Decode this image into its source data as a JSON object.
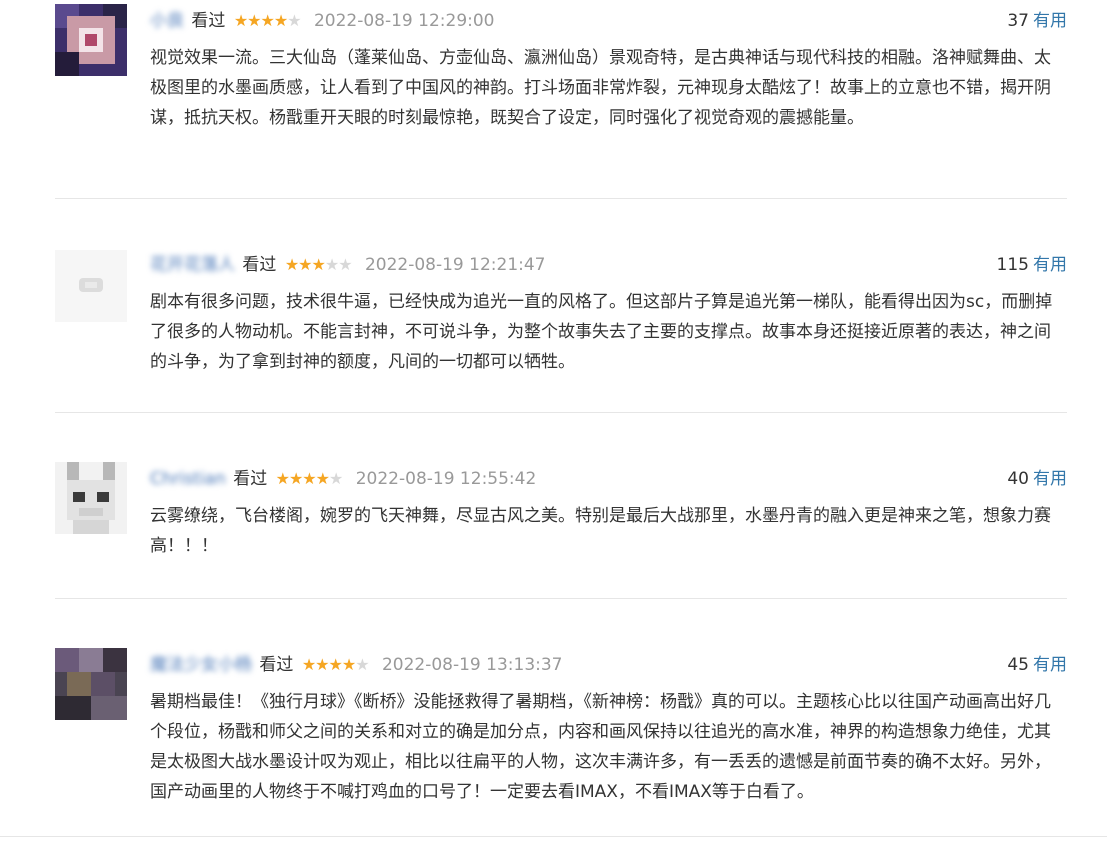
{
  "seen_label": "看过",
  "useful_label": "有用",
  "reviews": [
    {
      "user": "小良",
      "rating": 4,
      "date": "2022-08-19 12:29:00",
      "useful_count": "37",
      "body": "视觉效果一流。三大仙岛（蓬莱仙岛、方壶仙岛、瀛洲仙岛）景观奇特，是古典神话与现代科技的相融。洛神赋舞曲、太极图里的水墨画质感，让人看到了中国风的神韵。打斗场面非常炸裂，元神现身太酷炫了！故事上的立意也不错，揭开阴谋，抵抗天权。杨戬重开天眼的时刻最惊艳，既契合了设定，同时强化了视觉奇观的震撼能量。"
    },
    {
      "user": "花开花落人",
      "rating": 3,
      "date": "2022-08-19 12:21:47",
      "useful_count": "115",
      "body": "剧本有很多问题，技术很牛逼，已经快成为追光一直的风格了。但这部片子算是追光第一梯队，能看得出因为sc，而删掉了很多的人物动机。不能言封神，不可说斗争，为整个故事失去了主要的支撑点。故事本身还挺接近原著的表达，神之间的斗争，为了拿到封神的额度，凡间的一切都可以牺牲。"
    },
    {
      "user": "Christian",
      "rating": 4,
      "date": "2022-08-19 12:55:42",
      "useful_count": "40",
      "body": "云雾缭绕，飞台楼阁，婉罗的飞天神舞，尽显古风之美。特别是最后大战那里，水墨丹青的融入更是神来之笔，想象力赛高！！！"
    },
    {
      "user": "魔法少女小杨",
      "rating": 4,
      "date": "2022-08-19 13:13:37",
      "useful_count": "45",
      "body": "暑期档最佳！《独行月球》《断桥》没能拯救得了暑期档，《新神榜：杨戬》真的可以。主题核心比以往国产动画高出好几个段位，杨戬和师父之间的关系和对立的确是加分点，内容和画风保持以往追光的高水准，神界的构造想象力绝佳，尤其是太极图大战水墨设计叹为观止，相比以往扁平的人物，这次丰满许多，有一丢丢的遗憾是前面节奏的确不太好。另外，国产动画里的人物终于不喊打鸡血的口号了！一定要去看IMAX，不看IMAX等于白看了。"
    }
  ]
}
